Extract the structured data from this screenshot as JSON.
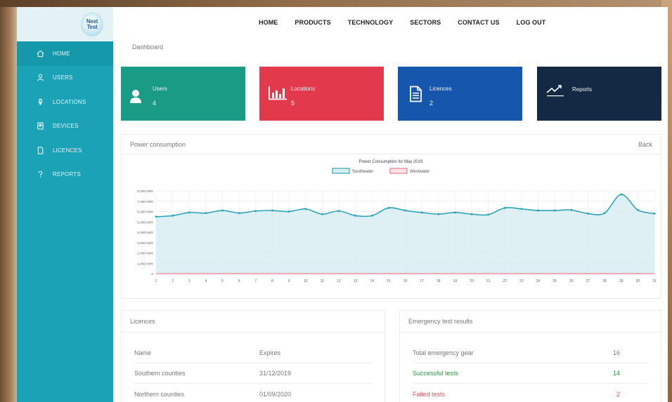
{
  "app": {
    "logo_line1": "Next",
    "logo_line2": "Test"
  },
  "topnav": [
    "HOME",
    "PRODUCTS",
    "TECHNOLOGY",
    "SECTORS",
    "CONTACT US",
    "LOG OUT"
  ],
  "sidebar": {
    "items": [
      {
        "label": "HOME",
        "icon": "home-icon"
      },
      {
        "label": "USERS",
        "icon": "user-icon"
      },
      {
        "label": "LOCATIONS",
        "icon": "map-pin-icon"
      },
      {
        "label": "DEVICES",
        "icon": "device-icon"
      },
      {
        "label": "LICENCES",
        "icon": "document-icon"
      },
      {
        "label": "REPORTS",
        "icon": "question-icon"
      }
    ]
  },
  "breadcrumb": "Dashboard",
  "cards": {
    "users": {
      "label": "Users",
      "value": "4"
    },
    "locations": {
      "label": "Locations",
      "value": "5"
    },
    "licences": {
      "label": "Licences",
      "value": "2"
    },
    "reports": {
      "label": "Reports"
    }
  },
  "power_panel": {
    "title": "Power consumption",
    "back_label": "Back"
  },
  "chart_data": {
    "type": "area",
    "title": "Power Consumption for May 2019",
    "legend_position": "top",
    "series": [
      {
        "name": "Southwater",
        "color": "#2fa6b8",
        "values": [
          5500,
          5600,
          5900,
          5850,
          6100,
          5850,
          6050,
          6100,
          6000,
          6250,
          5750,
          6050,
          5600,
          5600,
          6350,
          6100,
          5900,
          5750,
          5900,
          5750,
          5700,
          6350,
          6250,
          6100,
          6100,
          6150,
          5800,
          5850,
          7650,
          6150,
          5800
        ]
      },
      {
        "name": "Westwater",
        "color": "#f17b8b",
        "values": [
          0,
          0,
          0,
          0,
          0,
          0,
          0,
          0,
          0,
          0,
          0,
          0,
          0,
          0,
          0,
          0,
          0,
          0,
          0,
          0,
          0,
          0,
          0,
          0,
          0,
          0,
          0,
          0,
          0,
          0,
          0
        ]
      }
    ],
    "x": [
      1,
      2,
      3,
      4,
      5,
      6,
      7,
      8,
      9,
      10,
      11,
      12,
      13,
      14,
      15,
      16,
      17,
      18,
      19,
      20,
      21,
      22,
      23,
      24,
      25,
      26,
      27,
      28,
      29,
      30,
      31
    ],
    "y_ticks": [
      "8,000 kWh",
      "7,000 kWh",
      "6,000 kWh",
      "5,000 kWh",
      "4,000 kWh",
      "3,000 kWh",
      "2,000 kWh",
      "1,000 kWh",
      "0"
    ],
    "ylim": [
      0,
      8000
    ],
    "grid": true
  },
  "licences": {
    "title": "Licences",
    "headers": [
      "Name",
      "Expires"
    ],
    "rows": [
      [
        "Southern counties",
        "31/12/2019"
      ],
      [
        "Northern counties",
        "01/09/2020"
      ]
    ]
  },
  "emergency": {
    "title": "Emergency test results",
    "rows": [
      {
        "label": "Total emergency gear",
        "value": "16",
        "tone": "default"
      },
      {
        "label": "Successful tests",
        "value": "14",
        "tone": "green"
      },
      {
        "label": "Failed tests",
        "value": "2",
        "tone": "red"
      }
    ]
  }
}
